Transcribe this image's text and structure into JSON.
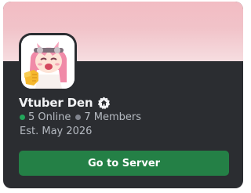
{
  "server": {
    "name": "Vtuber Den",
    "badge_icon": "partner-home-icon",
    "online_count": "5 Online",
    "member_count": "7 Members",
    "established": "Est. May 2026"
  },
  "actions": {
    "go_label": "Go to Server"
  },
  "colors": {
    "card_background": "#2b2d31",
    "banner": "#f2bcc3",
    "online_dot": "#23a55a",
    "members_dot": "#80848e",
    "button": "#248046"
  }
}
